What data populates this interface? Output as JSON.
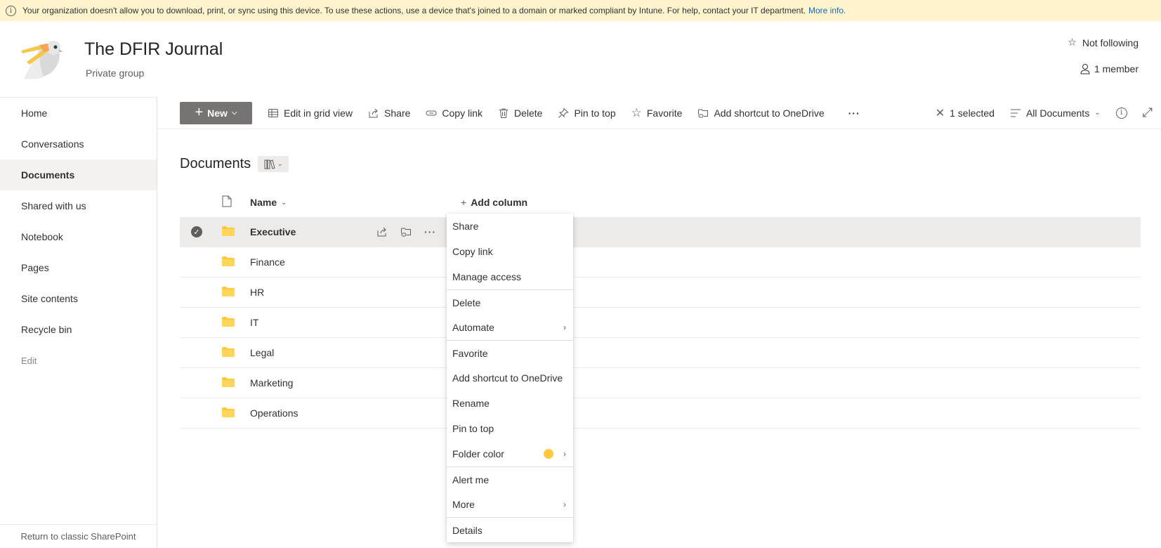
{
  "banner": {
    "icon": "info-icon",
    "message": "Your organization doesn't allow you to download, print, or sync using this device. To use these actions, use a device that's joined to a domain or marked compliant by Intune. For help, contact your IT department.",
    "link": "More info."
  },
  "site": {
    "title": "The DFIR Journal",
    "subtitle": "Private group",
    "follow": "Not following",
    "members": "1 member"
  },
  "nav": {
    "items": [
      {
        "label": "Home"
      },
      {
        "label": "Conversations"
      },
      {
        "label": "Documents",
        "active": true
      },
      {
        "label": "Shared with us"
      },
      {
        "label": "Notebook"
      },
      {
        "label": "Pages"
      },
      {
        "label": "Site contents"
      },
      {
        "label": "Recycle bin"
      }
    ],
    "edit": "Edit",
    "return_classic": "Return to classic SharePoint"
  },
  "toolbar": {
    "new": "New",
    "edit_grid": "Edit in grid view",
    "share": "Share",
    "copy_link": "Copy link",
    "delete": "Delete",
    "pin": "Pin to top",
    "favorite": "Favorite",
    "add_shortcut": "Add shortcut to OneDrive",
    "more": "···",
    "selected": "1 selected",
    "view": "All Documents"
  },
  "library": {
    "title": "Documents",
    "columns": {
      "name": "Name",
      "add_column": "Add column"
    },
    "folders": [
      {
        "name": "Executive",
        "selected": true
      },
      {
        "name": "Finance"
      },
      {
        "name": "HR"
      },
      {
        "name": "IT"
      },
      {
        "name": "Legal"
      },
      {
        "name": "Marketing"
      },
      {
        "name": "Operations"
      }
    ],
    "folder_color": "#ffc83d"
  },
  "context_menu": {
    "items": [
      {
        "label": "Share"
      },
      {
        "label": "Copy link"
      },
      {
        "label": "Manage access"
      },
      {
        "label": "Delete",
        "sep": true
      },
      {
        "label": "Automate",
        "submenu": true
      },
      {
        "label": "Favorite",
        "sep": true
      },
      {
        "label": "Add shortcut to OneDrive"
      },
      {
        "label": "Rename"
      },
      {
        "label": "Pin to top"
      },
      {
        "label": "Folder color",
        "submenu": true,
        "swatch": true
      },
      {
        "label": "Alert me",
        "sep": true
      },
      {
        "label": "More",
        "submenu": true
      },
      {
        "label": "Details",
        "sep": true
      }
    ]
  }
}
